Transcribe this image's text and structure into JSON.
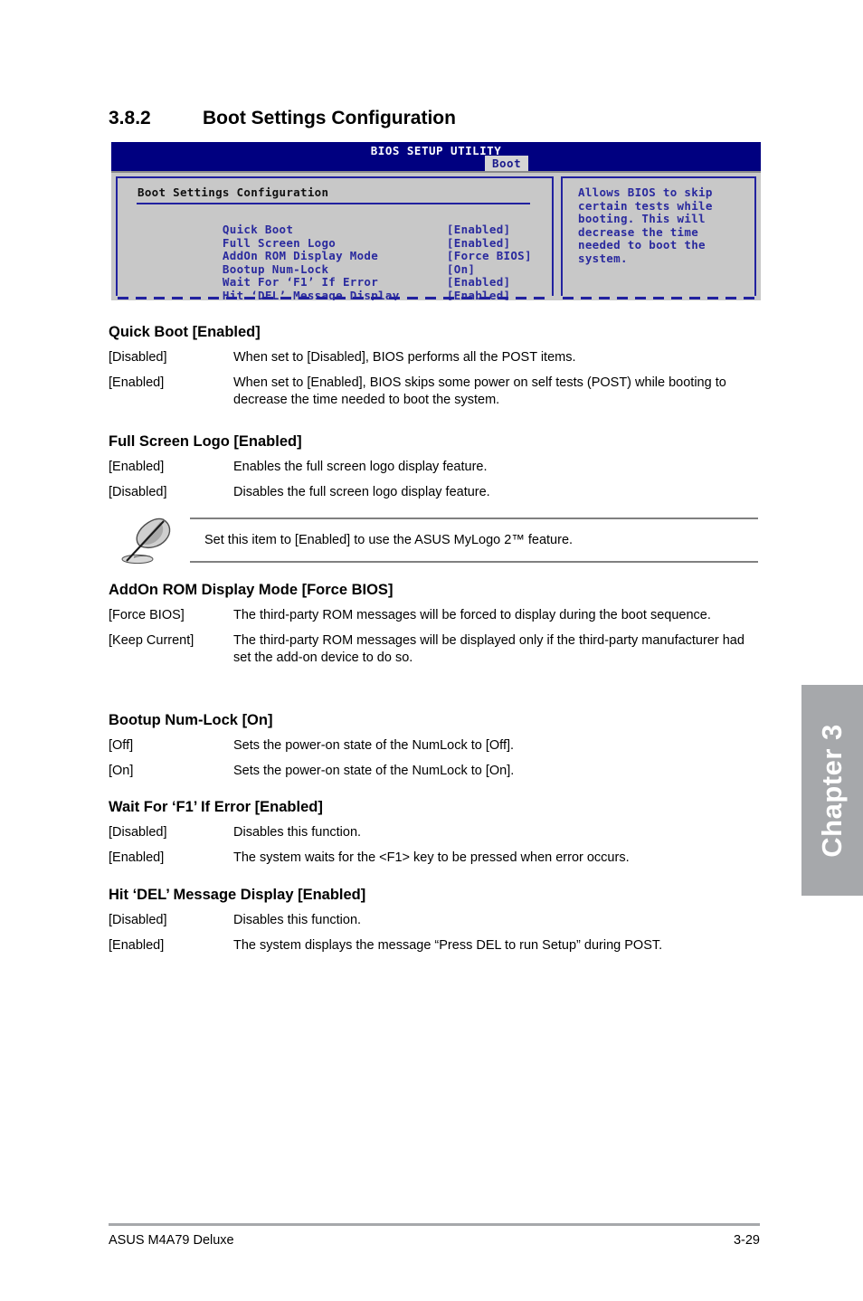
{
  "section": {
    "number": "3.8.2",
    "title": "Boot Settings Configuration"
  },
  "bios_screenshot": {
    "window_title": "BIOS SETUP UTILITY",
    "active_tab": "Boot",
    "panel_title": "Boot Settings Configuration",
    "items": [
      {
        "name": "Quick Boot",
        "value": "[Enabled]"
      },
      {
        "name": "Full Screen Logo",
        "value": "[Enabled]"
      },
      {
        "name": "AddOn ROM Display Mode",
        "value": "[Force BIOS]"
      },
      {
        "name": "Bootup Num-Lock",
        "value": "[On]"
      },
      {
        "name": "Wait For ‘F1’ If Error",
        "value": "[Enabled]"
      },
      {
        "name": "Hit ‘DEL’ Message Display",
        "value": "[Enabled]"
      }
    ],
    "help_lines": [
      "Allows BIOS to skip",
      "certain tests while",
      "booting. This will",
      "decrease the time",
      "needed to boot the",
      "system."
    ],
    "colors": {
      "titlebar": "#000080",
      "panel_bg": "#c8c8c8",
      "item_text": "#2a2a9e",
      "border": "#2222a0"
    }
  },
  "options": [
    {
      "heading": "Quick Boot [Enabled]",
      "rows": [
        {
          "key": "[Disabled]",
          "desc": "When set to [Disabled], BIOS performs all the POST items."
        },
        {
          "key": "[Enabled]",
          "desc": "When set to [Enabled], BIOS skips some power on self tests (POST) while booting to decrease the time needed to boot the system."
        }
      ]
    },
    {
      "heading": "Full Screen Logo [Enabled]",
      "rows": [
        {
          "key": "[Enabled]",
          "desc": "Enables the full screen logo display feature."
        },
        {
          "key": "[Disabled]",
          "desc": "Disables the full screen logo display feature."
        }
      ]
    },
    {
      "heading": "AddOn ROM Display Mode [Force BIOS]",
      "rows": [
        {
          "key": "[Force BIOS]",
          "desc": "The third-party ROM messages will be forced to display during the boot sequence."
        },
        {
          "key": "[Keep Current]",
          "desc": "The third-party ROM messages will be displayed only if the third-party manufacturer had set the add-on device to do so."
        }
      ]
    },
    {
      "heading": "Bootup Num-Lock [On]",
      "rows": [
        {
          "key": "[Off]",
          "desc": "Sets the power-on state of the NumLock to [Off]."
        },
        {
          "key": "[On]",
          "desc": "Sets the power-on state of the NumLock to [On]."
        }
      ]
    },
    {
      "heading": "Wait For ‘F1’ If Error [Enabled]",
      "rows": [
        {
          "key": "[Disabled]",
          "desc": "Disables this function."
        },
        {
          "key": "[Enabled]",
          "desc": "The system waits for the <F1> key to be pressed when error occurs."
        }
      ]
    },
    {
      "heading": "Hit ‘DEL’ Message Display [Enabled]",
      "rows": [
        {
          "key": "[Disabled]",
          "desc": "Disables this function."
        },
        {
          "key": "[Enabled]",
          "desc": "The system displays the message “Press DEL to run Setup” during POST."
        }
      ]
    }
  ],
  "note": {
    "text": "Set this item to [Enabled] to use the ASUS MyLogo 2™ feature.",
    "icon": "quill-pen-icon"
  },
  "chapter_tab": {
    "label": "Chapter 3",
    "color": "#a6a8ab"
  },
  "footer": {
    "left": "ASUS M4A79 Deluxe",
    "right": "3-29"
  }
}
